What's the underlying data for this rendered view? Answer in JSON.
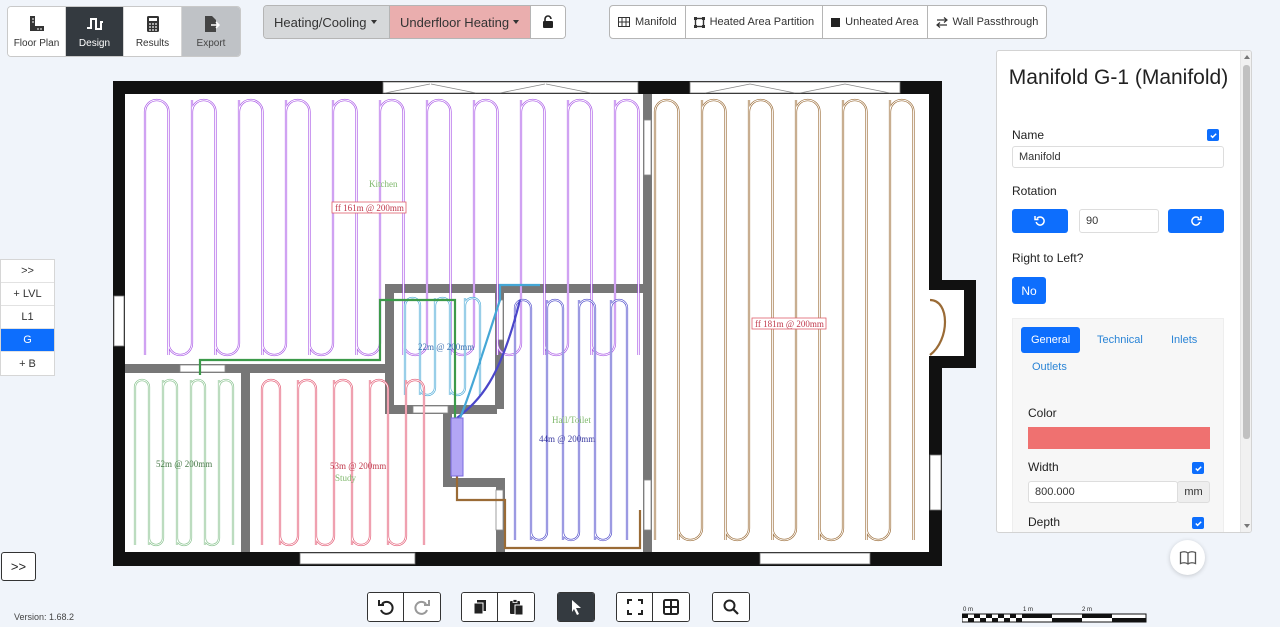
{
  "main_tabs": [
    {
      "label": "Floor Plan",
      "icon": "ruler-icon",
      "active": false
    },
    {
      "label": "Design",
      "icon": "pipe-icon",
      "active": true
    },
    {
      "label": "Results",
      "icon": "calculator-icon",
      "active": false
    },
    {
      "label": "Export",
      "icon": "export-icon",
      "active": false
    }
  ],
  "mode": {
    "system": "Heating/Cooling",
    "subsystem": "Underfloor Heating",
    "lock_icon": "unlock-icon"
  },
  "tools": [
    {
      "label": "Manifold",
      "icon": "grid-icon"
    },
    {
      "label": "Heated Area Partition",
      "icon": "square-outline-icon"
    },
    {
      "label": "Unheated Area",
      "icon": "filled-square-icon"
    },
    {
      "label": "Wall Passthrough",
      "icon": "arrows-icon"
    }
  ],
  "levels": {
    "expand": ">>",
    "add_level": "+ LVL",
    "items": [
      "L1",
      "G"
    ],
    "active": "G",
    "add_basement": "+ B"
  },
  "canvas_expand": ">>",
  "version": "Version: 1.68.2",
  "floor_plan": {
    "rooms": [
      {
        "name": "Kitchen",
        "loop": "ff 161m @ 200mm",
        "color": "#a855e6"
      },
      {
        "name": "",
        "loop": "ff 181m @ 200mm",
        "color": "#9a6b36"
      },
      {
        "name": "",
        "loop": "22m @ 200mm",
        "color": "#45a7d6"
      },
      {
        "name": "Hall/Toilet",
        "loop": "44m @ 200mm",
        "color": "#4a46c9"
      },
      {
        "name": "Study",
        "loop": "53m @ 200mm",
        "color": "#e2536e"
      },
      {
        "name": "",
        "loop": "52m @ 200mm",
        "color": "#84c08a"
      }
    ],
    "manifold_color": "#b3a6f5"
  },
  "panel": {
    "title": "Manifold G-1 (Manifold)",
    "name_label": "Name",
    "name_value": "Manifold",
    "rotation_label": "Rotation",
    "rotation_value": "90",
    "rtl_label": "Right to Left?",
    "rtl_value": "No",
    "tabs": [
      "General",
      "Technical",
      "Inlets",
      "Outlets"
    ],
    "active_tab": "General",
    "color_label": "Color",
    "color_value": "#ef7170",
    "width_label": "Width",
    "width_value": "800.000",
    "width_unit": "mm",
    "depth_label": "Depth"
  },
  "scale": {
    "labels": [
      "0 m",
      "1 m",
      "2 m"
    ]
  }
}
